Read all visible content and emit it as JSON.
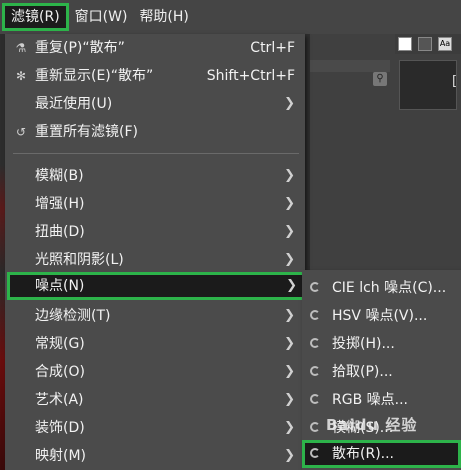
{
  "menubar": {
    "items": [
      {
        "label": "滤镜(R)"
      },
      {
        "label": "窗口(W)"
      },
      {
        "label": "帮助(H)"
      }
    ]
  },
  "right_panel": {
    "thumb_label": "["
  },
  "filters_menu": {
    "items": [
      {
        "label": "重复(P)“散布”",
        "shortcut": "Ctrl+F",
        "icon": "repeat-icon"
      },
      {
        "label": "重新显示(E)“散布”",
        "shortcut": "Shift+Ctrl+F",
        "icon": "reshow-icon"
      },
      {
        "label": "最近使用(U)",
        "icon": "none"
      },
      {
        "label": "重置所有滤镜(F)",
        "icon": "reset-icon"
      },
      {
        "label": "模糊(B)"
      },
      {
        "label": "增强(H)"
      },
      {
        "label": "扭曲(D)"
      },
      {
        "label": "光照和阴影(L)"
      },
      {
        "label": "噪点(N)"
      },
      {
        "label": "边缘检测(T)"
      },
      {
        "label": "常规(G)"
      },
      {
        "label": "合成(O)"
      },
      {
        "label": "艺术(A)"
      },
      {
        "label": "装饰(D)"
      },
      {
        "label": "映射(M)"
      }
    ]
  },
  "noise_submenu": {
    "items": [
      {
        "label": "CIE lch 噪点(C)..."
      },
      {
        "label": "HSV 噪点(V)..."
      },
      {
        "label": "投掷(H)..."
      },
      {
        "label": "拾取(P)..."
      },
      {
        "label": "RGB 噪点..."
      },
      {
        "label": "模糊(S)..."
      },
      {
        "label": "散布(R)..."
      }
    ]
  },
  "watermark": "Baidu 经验",
  "colors": {
    "highlight_border": "#2db34a",
    "menu_bg": "#4b4b4b",
    "highlight_bg": "#1b1b1b"
  }
}
